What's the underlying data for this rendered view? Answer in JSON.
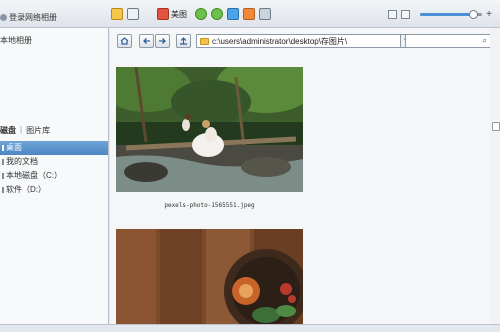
{
  "app": {
    "title": ""
  },
  "topbar": {
    "login_label": "登录网络相册",
    "meitu_label": "美图",
    "icons": [
      "add-folder-icon",
      "slideshow-icon",
      "meitu-icon",
      "rotate-left-icon",
      "rotate-right-icon",
      "delete-icon",
      "batch-icon",
      "comment-icon"
    ],
    "view_icons": [
      "grid-view-icon",
      "detail-view-icon"
    ],
    "zoom_fraction": 0.86,
    "zoom_plus": "+"
  },
  "sidebar": {
    "local_album_label": "本地相册",
    "tabs": [
      {
        "label": "磁盘",
        "active": true
      },
      {
        "label": "图片库",
        "active": false
      }
    ],
    "tab_separator": "|",
    "tree": [
      {
        "label": "桌面",
        "selected": true
      },
      {
        "label": "我的文档",
        "selected": false
      },
      {
        "label": "本地磁盘（C:）",
        "selected": false
      },
      {
        "label": "软件（D:）",
        "selected": false
      }
    ]
  },
  "nav": {
    "home_icon": "home-icon",
    "back_icon": "back-icon",
    "forward_icon": "forward-icon",
    "up_icon": "up-icon",
    "path": "c:\\users\\administrator\\desktop\\存图片\\",
    "search_placeholder": ""
  },
  "gallery": {
    "items": [
      {
        "caption": "pexels-photo-1565551.jpeg"
      },
      {
        "caption": ""
      }
    ]
  },
  "colors": {
    "selection": "#4c86c3",
    "accent": "#2f5f98",
    "toolbar_bg": "#dfe4ea"
  }
}
